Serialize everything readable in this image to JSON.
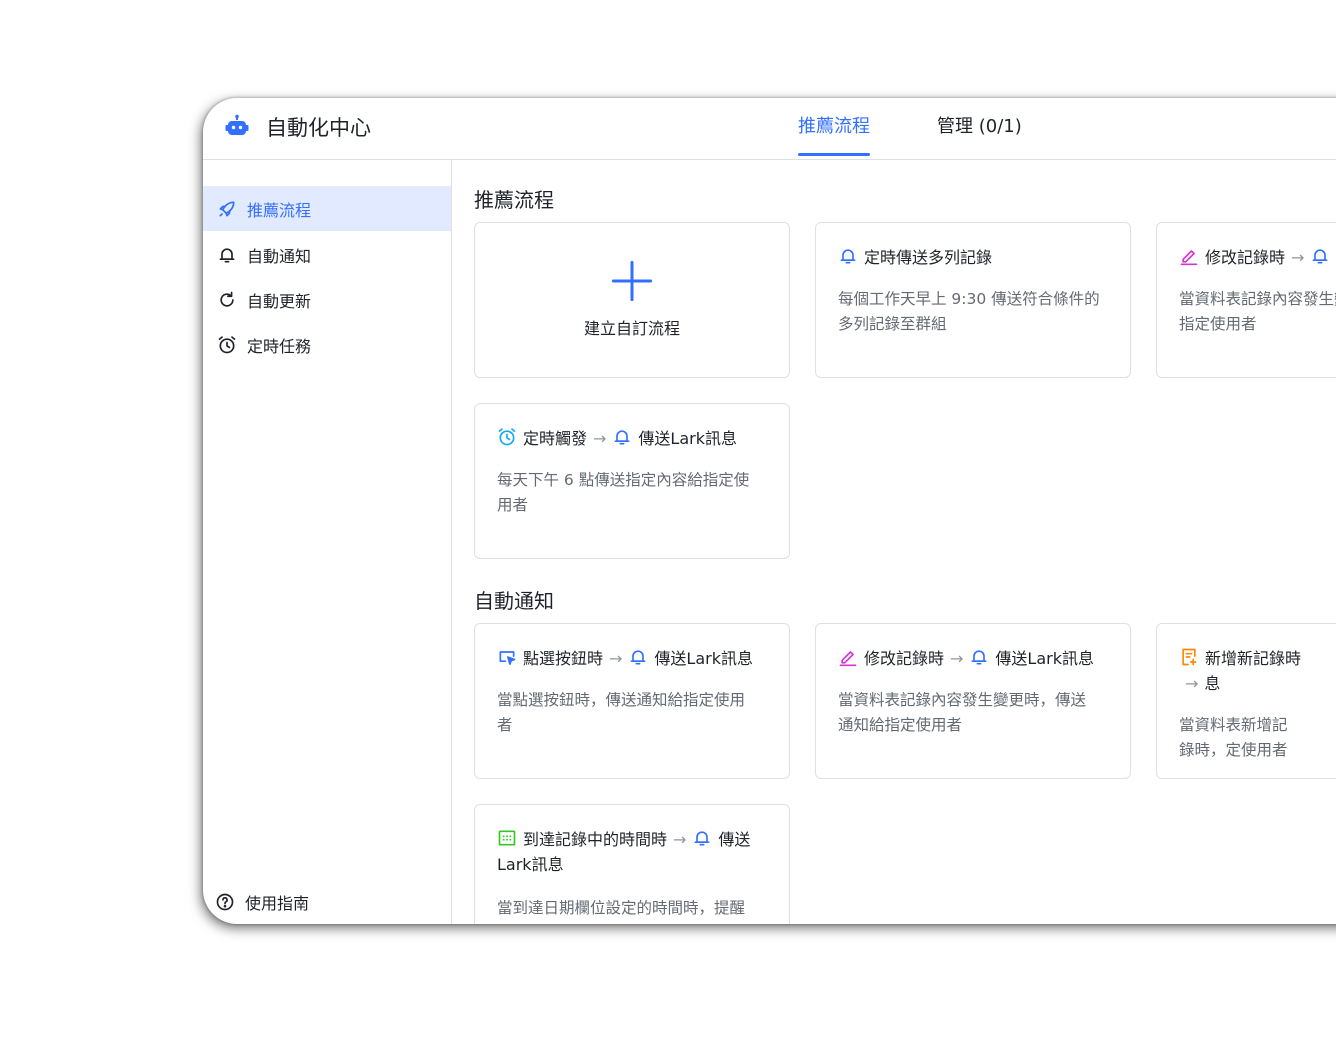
{
  "app": {
    "title": "自動化中心"
  },
  "tabs": {
    "recommended": "推薦流程",
    "manage": "管理 (0/1)"
  },
  "sidebar": {
    "items": [
      {
        "label": "推薦流程",
        "icon": "rocket-icon",
        "active": true
      },
      {
        "label": "自動通知",
        "icon": "bell-icon"
      },
      {
        "label": "自動更新",
        "icon": "refresh-icon"
      },
      {
        "label": "定時任務",
        "icon": "alarm-clock-icon"
      }
    ],
    "guide": "使用指南"
  },
  "sections": {
    "recommended": {
      "title": "推薦流程",
      "create_label": "建立自訂流程",
      "cards": [
        {
          "trigger": "定時傳送多列記錄",
          "desc": "每個工作天早上 9:30 傳送符合條件的多列記錄至群組"
        },
        {
          "trigger": "修改記錄時",
          "arrow": "→",
          "desc": "當資料表記錄內容發生變更時，傳送通知給指定使用者"
        },
        {
          "trigger": "定時觸發",
          "arrow": "→",
          "action": "傳送Lark訊息",
          "desc": "每天下午 6 點傳送指定內容給指定使用者"
        }
      ]
    },
    "notify": {
      "title": "自動通知",
      "cards": [
        {
          "trigger": "點選按鈕時",
          "arrow": "→",
          "action": "傳送Lark訊息",
          "desc": "當點選按鈕時，傳送通知給指定使用者"
        },
        {
          "trigger": "修改記錄時",
          "arrow": "→",
          "action": "傳送Lark訊息",
          "desc": "當資料表記錄內容發生變更時，傳送通知給指定使用者"
        },
        {
          "trigger": "新增新記錄時",
          "arrow": "→",
          "action": "息",
          "desc": "當資料表新增記錄時，定使用者"
        },
        {
          "trigger": "到達記錄中的時間時",
          "arrow": "→",
          "action": "傳送Lark訊息",
          "desc": "當到達日期欄位設定的時間時，提醒"
        }
      ]
    }
  },
  "colors": {
    "accent": "#3370ff",
    "pink": "#d136d1",
    "orange": "#ff8800",
    "green": "#34c724",
    "cyan": "#14a9f5"
  }
}
